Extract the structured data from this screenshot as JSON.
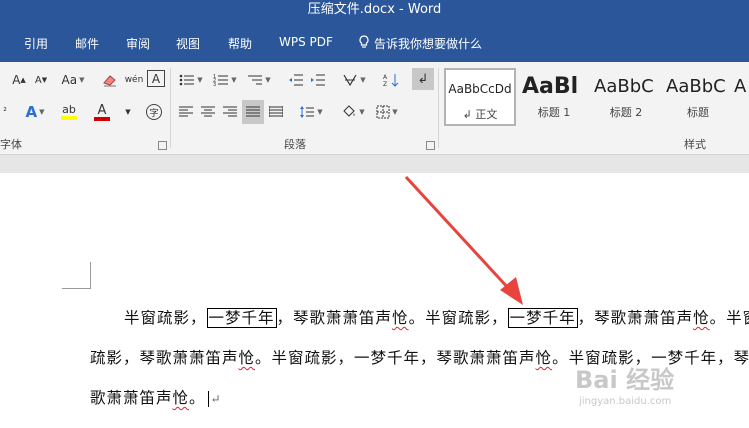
{
  "window": {
    "title": "压缩文件.docx  -  Word"
  },
  "menu": {
    "items": [
      "引用",
      "邮件",
      "审阅",
      "视图",
      "帮助",
      "WPS PDF"
    ],
    "tell_me": "告诉我你想要做什么"
  },
  "ribbon": {
    "font_group_label": "字体",
    "paragraph_group_label": "段落",
    "styles_group_label": "样式",
    "font_buttons": {
      "grow": "A",
      "shrink": "A",
      "change_case": "Aa",
      "phonetic": "wén",
      "char_border": "A",
      "text_effect": "A",
      "highlight": "ab",
      "font_color": "A",
      "enclose": "字"
    },
    "styles": [
      {
        "preview": "AaBbCcDd",
        "name": "正文",
        "selected": true
      },
      {
        "preview": "AaBl",
        "name": "标题 1"
      },
      {
        "preview": "AaBbC",
        "name": "标题 2"
      },
      {
        "preview": "AaBbC",
        "name": "标题"
      },
      {
        "preview": "A",
        "name": ""
      }
    ]
  },
  "document": {
    "line1": {
      "t1": "半窗疏影，",
      "box1": "一梦千年",
      "t2": "，琴歌萧萧笛声",
      "sq1": "怆",
      "t3": "。半窗疏影，",
      "box2": "一梦千年",
      "t4": "，琴歌萧萧笛声",
      "sq2": "怆",
      "t5": "。半窗"
    },
    "line2": {
      "t1": "疏影，琴歌萧萧笛声",
      "sq1": "怆",
      "t2": "。半窗疏影，一梦千年，琴歌萧萧笛声",
      "sq2": "怆",
      "t3": "。半窗疏影，一梦千年，琴"
    },
    "line3": {
      "t1": "歌萧萧笛声",
      "sq1": "怆",
      "t2": "。"
    }
  },
  "watermark": {
    "brand": "Bai 经验",
    "url": "jingyan.baidu.com"
  },
  "colors": {
    "title_bar": "#2b579a",
    "ribbon_bg": "#f3f3f3",
    "arrow": "#e8433d",
    "highlight_yellow": "#ffff00",
    "font_red": "#d00000"
  }
}
